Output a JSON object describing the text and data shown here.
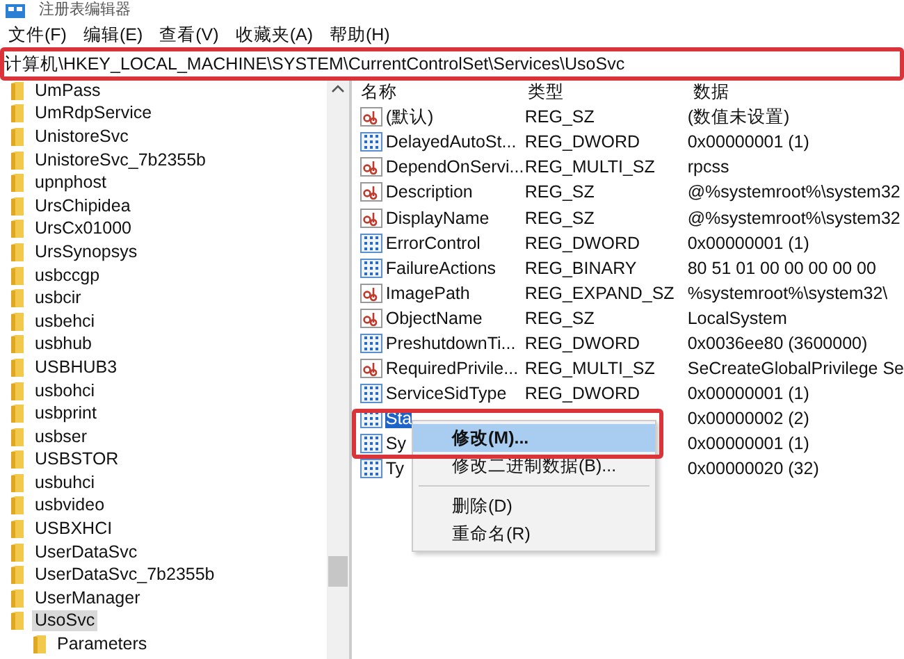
{
  "window": {
    "title": "注册表编辑器"
  },
  "menu": [
    "文件(F)",
    "编辑(E)",
    "查看(V)",
    "收藏夹(A)",
    "帮助(H)"
  ],
  "address": "计算机\\HKEY_LOCAL_MACHINE\\SYSTEM\\CurrentControlSet\\Services\\UsoSvc",
  "tree": [
    {
      "label": "UmPass",
      "selected": false
    },
    {
      "label": "UmRdpService",
      "selected": false
    },
    {
      "label": "UnistoreSvc",
      "selected": false
    },
    {
      "label": "UnistoreSvc_7b2355b",
      "selected": false
    },
    {
      "label": "upnphost",
      "selected": false
    },
    {
      "label": "UrsChipidea",
      "selected": false
    },
    {
      "label": "UrsCx01000",
      "selected": false
    },
    {
      "label": "UrsSynopsys",
      "selected": false
    },
    {
      "label": "usbccgp",
      "selected": false
    },
    {
      "label": "usbcir",
      "selected": false
    },
    {
      "label": "usbehci",
      "selected": false
    },
    {
      "label": "usbhub",
      "selected": false
    },
    {
      "label": "USBHUB3",
      "selected": false
    },
    {
      "label": "usbohci",
      "selected": false
    },
    {
      "label": "usbprint",
      "selected": false
    },
    {
      "label": "usbser",
      "selected": false
    },
    {
      "label": "USBSTOR",
      "selected": false
    },
    {
      "label": "usbuhci",
      "selected": false
    },
    {
      "label": "usbvideo",
      "selected": false
    },
    {
      "label": "USBXHCI",
      "selected": false
    },
    {
      "label": "UserDataSvc",
      "selected": false
    },
    {
      "label": "UserDataSvc_7b2355b",
      "selected": false
    },
    {
      "label": "UserManager",
      "selected": false
    },
    {
      "label": "UsoSvc",
      "selected": true,
      "children": [
        {
          "label": "Parameters",
          "selected": false
        }
      ]
    }
  ],
  "columns": [
    "名称",
    "类型",
    "数据"
  ],
  "values": [
    {
      "kind": "string",
      "name": "(默认)",
      "type": "REG_SZ",
      "data": "(数值未设置)",
      "selected": false
    },
    {
      "kind": "binary",
      "name": "DelayedAutoSt...",
      "type": "REG_DWORD",
      "data": "0x00000001 (1)",
      "selected": false
    },
    {
      "kind": "string",
      "name": "DependOnServi...",
      "type": "REG_MULTI_SZ",
      "data": "rpcss",
      "selected": false
    },
    {
      "kind": "string",
      "name": "Description",
      "type": "REG_SZ",
      "data": "@%systemroot%\\system32",
      "selected": false
    },
    {
      "kind": "string",
      "name": "DisplayName",
      "type": "REG_SZ",
      "data": "@%systemroot%\\system32",
      "selected": false
    },
    {
      "kind": "binary",
      "name": "ErrorControl",
      "type": "REG_DWORD",
      "data": "0x00000001 (1)",
      "selected": false
    },
    {
      "kind": "binary",
      "name": "FailureActions",
      "type": "REG_BINARY",
      "data": "80 51 01 00 00 00 00 00",
      "selected": false
    },
    {
      "kind": "string",
      "name": "ImagePath",
      "type": "REG_EXPAND_SZ",
      "data": "%systemroot%\\system32\\",
      "selected": false
    },
    {
      "kind": "string",
      "name": "ObjectName",
      "type": "REG_SZ",
      "data": "LocalSystem",
      "selected": false
    },
    {
      "kind": "binary",
      "name": "PreshutdownTi...",
      "type": "REG_DWORD",
      "data": "0x0036ee80 (3600000)",
      "selected": false
    },
    {
      "kind": "string",
      "name": "RequiredPrivile...",
      "type": "REG_MULTI_SZ",
      "data": "SeCreateGlobalPrivilege Se",
      "selected": false
    },
    {
      "kind": "binary",
      "name": "ServiceSidType",
      "type": "REG_DWORD",
      "data": "0x00000001 (1)",
      "selected": false
    },
    {
      "kind": "binary",
      "name": "Sta",
      "data": "0x00000002 (2)",
      "selected": true
    },
    {
      "kind": "binary",
      "name": "Sy",
      "data": "0x00000001 (1)",
      "selected": false
    },
    {
      "kind": "binary",
      "name": "Ty",
      "data": "0x00000020 (32)",
      "selected": false
    }
  ],
  "context_menu": [
    {
      "label": "修改(M)...",
      "selected": true
    },
    {
      "label": "修改二进制数据(B)...",
      "selected": false,
      "separator_after": true
    },
    {
      "label": "删除(D)",
      "selected": false
    },
    {
      "label": "重命名(R)",
      "selected": false
    }
  ]
}
